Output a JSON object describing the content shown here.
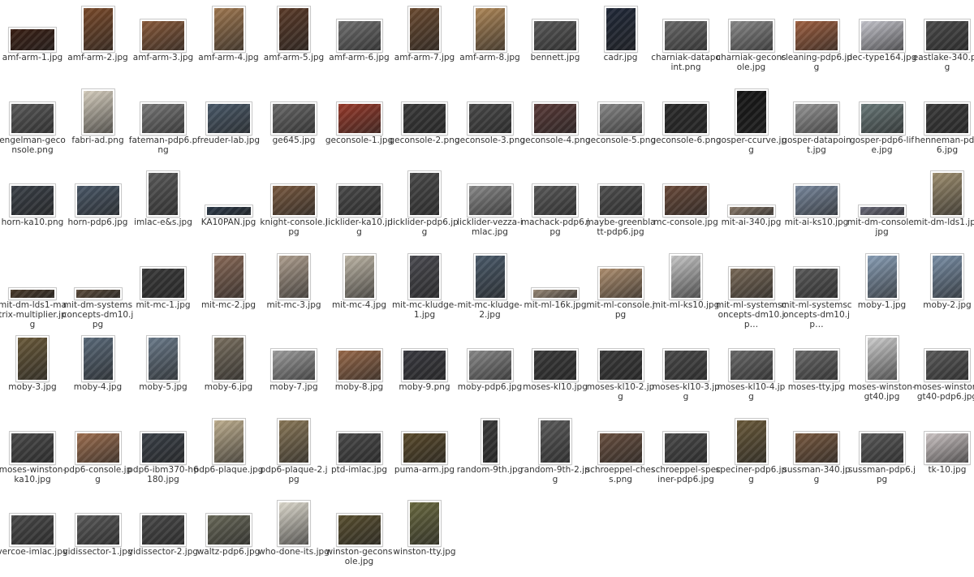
{
  "files": [
    [
      "amf-arm-1.jpg",
      "wide",
      "#3a1f14"
    ],
    [
      "amf-arm-2.jpg",
      "port",
      "#7a4a2a"
    ],
    [
      "amf-arm-3.jpg",
      "land",
      "#8a5a3a"
    ],
    [
      "amf-arm-4.jpg",
      "port",
      "#a07850"
    ],
    [
      "amf-arm-5.jpg",
      "port",
      "#5a3a28"
    ],
    [
      "amf-arm-6.jpg",
      "land",
      "#707070"
    ],
    [
      "amf-arm-7.jpg",
      "port",
      "#6a4a30"
    ],
    [
      "amf-arm-8.jpg",
      "port",
      "#b08858"
    ],
    [
      "bennett.jpg",
      "land",
      "#5a5a5a"
    ],
    [
      "cadr.jpg",
      "port",
      "#202838"
    ],
    [
      "charniak-datapoint.png",
      "land",
      "#6a6a6a"
    ],
    [
      "charniak-geconsole.jpg",
      "land",
      "#8a8a8a"
    ],
    [
      "cleaning-pdp6.jpg",
      "land",
      "#a06040"
    ],
    [
      "dec-type164.jpg",
      "land",
      "#c8c8d0"
    ],
    [
      "eastlake-340.png",
      "land",
      "#4a4a4a"
    ],
    [
      "engelman-geconsole.png",
      "land",
      "#5a5a5a"
    ],
    [
      "fabri-ad.png",
      "port",
      "#d8d0c0"
    ],
    [
      "fateman-pdp6.png",
      "land",
      "#7a7a7a"
    ],
    [
      "freuder-lab.jpg",
      "land",
      "#4a5a6a"
    ],
    [
      "ge645.jpg",
      "land",
      "#6a6a6a"
    ],
    [
      "geconsole-1.jpg",
      "land",
      "#9a3a2a"
    ],
    [
      "geconsole-2.png",
      "land",
      "#3a3a3a"
    ],
    [
      "geconsole-3.png",
      "land",
      "#4a4a4a"
    ],
    [
      "geconsole-4.png",
      "land",
      "#5a3a38"
    ],
    [
      "geconsole-5.png",
      "land",
      "#8a8a8a"
    ],
    [
      "geconsole-6.png",
      "land",
      "#2a2a2a"
    ],
    [
      "gosper-ccurve.jpg",
      "port",
      "#151515"
    ],
    [
      "gosper-datapoint.jpg",
      "land",
      "#9a9a9a"
    ],
    [
      "gosper-pdp6-life.jpg",
      "land",
      "#6a7a7a"
    ],
    [
      "henneman-pdp6.jpg",
      "land",
      "#3a3a3a"
    ],
    [
      "horn-ka10.png",
      "land",
      "#3a4048"
    ],
    [
      "horn-pdp6.jpg",
      "land",
      "#4a5868"
    ],
    [
      "imlac-e&s.jpg",
      "port",
      "#5a5a5a"
    ],
    [
      "KA10PAN.jpg",
      "strip",
      "#2a3848"
    ],
    [
      "knight-console.jpg",
      "land",
      "#7a5a40"
    ],
    [
      "licklider-ka10.jpg",
      "land",
      "#4a4a4a"
    ],
    [
      "licklider-pdp6.jpg",
      "port",
      "#4a4a4a"
    ],
    [
      "licklider-vezza-imlac.jpg",
      "land",
      "#8a8a8a"
    ],
    [
      "machack-pdp6.jpg",
      "land",
      "#5a5a5a"
    ],
    [
      "maybe-greenblatt-pdp6.jpg",
      "land",
      "#505050"
    ],
    [
      "mc-console.jpg",
      "land",
      "#6a4a3a"
    ],
    [
      "mit-ai-340.jpg",
      "strip",
      "#8a7a6a"
    ],
    [
      "mit-ai-ks10.jpg",
      "land",
      "#7a8aa0"
    ],
    [
      "mit-dm-console.jpg",
      "strip",
      "#6a6a7a"
    ],
    [
      "mit-dm-lds1.jpg",
      "port",
      "#a09070"
    ],
    [
      "mit-dm-lds1-matrix-multiplier.jpg",
      "strip",
      "#4a3a2a"
    ],
    [
      "mit-dm-systemsconcepts-dm10.jpg",
      "strip",
      "#5a4a3a"
    ],
    [
      "mit-mc-1.jpg",
      "land",
      "#3a3a3a"
    ],
    [
      "mit-mc-2.jpg",
      "port",
      "#8a6a58"
    ],
    [
      "mit-mc-3.jpg",
      "port",
      "#b0a090"
    ],
    [
      "mit-mc-4.jpg",
      "port",
      "#c0b8a8"
    ],
    [
      "mit-mc-kludge-1.jpg",
      "port",
      "#4a4a50"
    ],
    [
      "mit-mc-kludge-2.jpg",
      "port",
      "#4a5a6a"
    ],
    [
      "mit-ml-16k.jpg",
      "strip",
      "#9a8a78"
    ],
    [
      "mit-ml-console.jpg",
      "land",
      "#b09070"
    ],
    [
      "mit-ml-ks10.jpg",
      "port",
      "#c8c8c8"
    ],
    [
      "mit-ml-systemsconcepts-dm10.jpg",
      "land",
      "#7a6a58"
    ],
    [
      "mit-ml-systemsconcepts-dm10.jpg",
      "land",
      "#5a5a5a"
    ],
    [
      "moby-1.jpg",
      "port",
      "#8aa0b8"
    ],
    [
      "moby-2.jpg",
      "port",
      "#7a90a8"
    ],
    [
      "moby-3.jpg",
      "port",
      "#6a5a3a"
    ],
    [
      "moby-4.jpg",
      "port",
      "#5a6a7a"
    ],
    [
      "moby-5.jpg",
      "port",
      "#6a7a8a"
    ],
    [
      "moby-6.jpg",
      "port",
      "#7a7060"
    ],
    [
      "moby-7.jpg",
      "land",
      "#a0a0a0"
    ],
    [
      "moby-8.jpg",
      "land",
      "#9a6a4a"
    ],
    [
      "moby-9.png",
      "land",
      "#3a3a40"
    ],
    [
      "moby-pdp6.jpg",
      "land",
      "#8a8a8a"
    ],
    [
      "moses-kl10.jpg",
      "land",
      "#3a3a3a"
    ],
    [
      "moses-kl10-2.jpg",
      "land",
      "#3a3a3a"
    ],
    [
      "moses-kl10-3.jpg",
      "land",
      "#4a4a4a"
    ],
    [
      "moses-kl10-4.jpg",
      "land",
      "#6a6a6a"
    ],
    [
      "moses-tty.jpg",
      "land",
      "#6a6a6a"
    ],
    [
      "moses-winston-gt40.jpg",
      "port",
      "#d0d0d0"
    ],
    [
      "moses-winston-gt40-pdp6.jpg",
      "land",
      "#5a5a5a"
    ],
    [
      "moses-winston-ka10.jpg",
      "land",
      "#4a4a4a"
    ],
    [
      "pdp6-console.jpg",
      "land",
      "#a07050"
    ],
    [
      "pdp6-ibm370-h6180.jpg",
      "land",
      "#3a4048"
    ],
    [
      "pdp6-plaque.jpg",
      "port",
      "#c0b090"
    ],
    [
      "pdp6-plaque-2.jpg",
      "port",
      "#8a7858"
    ],
    [
      "ptd-imlac.jpg",
      "land",
      "#4a4a4a"
    ],
    [
      "puma-arm.jpg",
      "land",
      "#5a4a2a"
    ],
    [
      "random-9th.jpg",
      "tall",
      "#3a3a3a"
    ],
    [
      "random-9th-2.jpg",
      "port",
      "#5a5a5a"
    ],
    [
      "schroeppel-chess.png",
      "land",
      "#6a5040"
    ],
    [
      "schroeppel-speciner-pdp6.jpg",
      "land",
      "#4a4a4a"
    ],
    [
      "speciner-pdp6.jpg",
      "port",
      "#6a5a3a"
    ],
    [
      "sussman-340.jpg",
      "land",
      "#7a5a40"
    ],
    [
      "sussman-pdp6.jpg",
      "land",
      "#5a5a5a"
    ],
    [
      "tk-10.jpg",
      "land",
      "#d0c8c8"
    ],
    [
      "vercoe-imlac.jpg",
      "land",
      "#4a4a4a"
    ],
    [
      "vidissector-1.jpg",
      "land",
      "#5a5a5a"
    ],
    [
      "vidissector-2.jpg",
      "land",
      "#4a4a4a"
    ],
    [
      "waltz-pdp6.jpg",
      "land",
      "#6a6a5a"
    ],
    [
      "who-done-its.jpg",
      "port",
      "#e0dcd0"
    ],
    [
      "winston-geconsole.jpg",
      "land",
      "#5a5030"
    ],
    [
      "winston-tty.jpg",
      "port",
      "#6a6a40"
    ]
  ],
  "labels_display": [
    "amf-arm-1.jpg",
    "amf-arm-2.jpg",
    "amf-arm-3.jpg",
    "amf-arm-4.jpg",
    "amf-arm-5.jpg",
    "amf-arm-6.jpg",
    "amf-arm-7.jpg",
    "amf-arm-8.jpg",
    "bennett.jpg",
    "cadr.jpg",
    "charniak-datapoint.png",
    "charniak-geconsole.jpg",
    "cleaning-pdp6.jpg",
    "dec-type164.jpg",
    "eastlake-340.png",
    "engelman-geconsole.png",
    "fabri-ad.png",
    "fateman-pdp6.png",
    "freuder-lab.jpg",
    "ge645.jpg",
    "geconsole-1.jpg",
    "geconsole-2.png",
    "geconsole-3.png",
    "geconsole-4.png",
    "geconsole-5.png",
    "geconsole-6.png",
    "gosper-ccurve.jpg",
    "gosper-datapoint.jpg",
    "gosper-pdp6-life.jpg",
    "henneman-pdp6.jpg",
    "horn-ka10.png",
    "horn-pdp6.jpg",
    "imlac-e&s.jpg",
    "KA10PAN.jpg",
    "knight-console.jpg",
    "licklider-ka10.jpg",
    "licklider-pdp6.jpg",
    "licklider-vezza-imlac.jpg",
    "machack-pdp6.jpg",
    "maybe-greenblatt-pdp6.jpg",
    "mc-console.jpg",
    "mit-ai-340.jpg",
    "mit-ai-ks10.jpg",
    "mit-dm-console.jpg",
    "mit-dm-lds1.jpg",
    "mit-dm-lds1-matrix-multiplier.jpg",
    "mit-dm-systemsconcepts-dm10.jpg",
    "mit-mc-1.jpg",
    "mit-mc-2.jpg",
    "mit-mc-3.jpg",
    "mit-mc-4.jpg",
    "mit-mc-kludge-1.jpg",
    "mit-mc-kludge-2.jpg",
    "mit-ml-16k.jpg",
    "mit-ml-console.jpg",
    "mit-ml-ks10.jpg",
    "mit-ml-systemsconcepts-dm10.jp…",
    "mit-ml-systemsconcepts-dm10.jp…",
    "moby-1.jpg",
    "moby-2.jpg",
    "moby-3.jpg",
    "moby-4.jpg",
    "moby-5.jpg",
    "moby-6.jpg",
    "moby-7.jpg",
    "moby-8.jpg",
    "moby-9.png",
    "moby-pdp6.jpg",
    "moses-kl10.jpg",
    "moses-kl10-2.jpg",
    "moses-kl10-3.jpg",
    "moses-kl10-4.jpg",
    "moses-tty.jpg",
    "moses-winston-gt40.jpg",
    "moses-winston-gt40-pdp6.jpg",
    "moses-winston-ka10.jpg",
    "pdp6-console.jpg",
    "pdp6-ibm370-h6180.jpg",
    "pdp6-plaque.jpg",
    "pdp6-plaque-2.jpg",
    "ptd-imlac.jpg",
    "puma-arm.jpg",
    "random-9th.jpg",
    "random-9th-2.jpg",
    "schroeppel-chess.png",
    "schroeppel-speciner-pdp6.jpg",
    "speciner-pdp6.jpg",
    "sussman-340.jpg",
    "sussman-pdp6.jpg",
    "tk-10.jpg",
    "vercoe-imlac.jpg",
    "vidissector-1.jpg",
    "vidissector-2.jpg",
    "waltz-pdp6.jpg",
    "who-done-its.jpg",
    "winston-geconsole.jpg",
    "winston-tty.jpg"
  ]
}
